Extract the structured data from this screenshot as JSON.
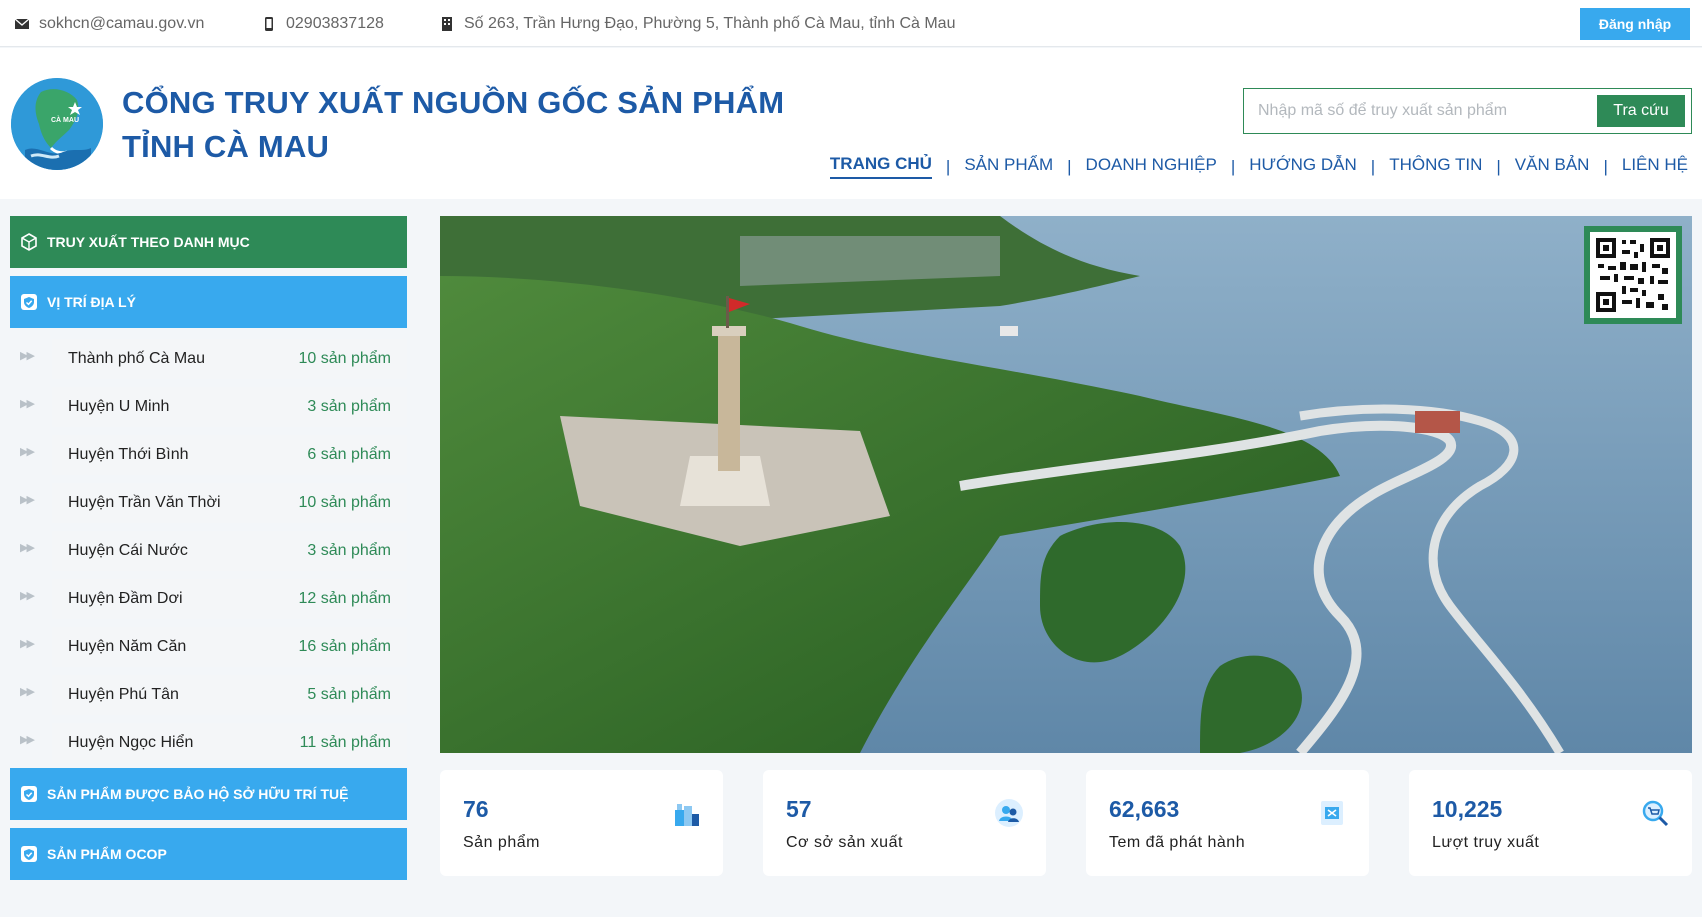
{
  "topbar": {
    "email": "sokhcn@camau.gov.vn",
    "phone": "02903837128",
    "address": "Số 263, Trần Hưng Đạo, Phường 5, Thành phố Cà Mau, tỉnh Cà Mau",
    "login_label": "Đăng nhập"
  },
  "header": {
    "logo_text": "CÀ MAU",
    "title_line1": "CỔNG TRUY XUẤT NGUỒN GỐC SẢN PHẨM",
    "title_line2": "TỈNH CÀ MAU",
    "search_placeholder": "Nhập mã số để truy xuất sản phẩm",
    "search_button": "Tra cứu"
  },
  "nav": {
    "items": [
      {
        "label": "TRANG CHỦ",
        "active": true
      },
      {
        "label": "SẢN PHẨM"
      },
      {
        "label": "DOANH NGHIỆP"
      },
      {
        "label": "HƯỚNG DẪN"
      },
      {
        "label": "THÔNG TIN"
      },
      {
        "label": "VĂN BẢN"
      },
      {
        "label": "LIÊN HỆ"
      }
    ]
  },
  "sidebar": {
    "category_header": "TRUY XUẤT THEO DANH MỤC",
    "geo_header": "VỊ TRÍ ĐỊA LÝ",
    "locations": [
      {
        "name": "Thành phố Cà Mau",
        "count": "10 sản phẩm"
      },
      {
        "name": "Huyện U Minh",
        "count": "3 sản phẩm"
      },
      {
        "name": "Huyện Thới Bình",
        "count": "6 sản phẩm"
      },
      {
        "name": "Huyện Trần Văn Thời",
        "count": "10 sản phẩm"
      },
      {
        "name": "Huyện Cái Nước",
        "count": "3 sản phẩm"
      },
      {
        "name": "Huyện Đầm Dơi",
        "count": "12 sản phẩm"
      },
      {
        "name": "Huyện Năm Căn",
        "count": "16 sản phẩm"
      },
      {
        "name": "Huyện Phú Tân",
        "count": "5 sản phẩm"
      },
      {
        "name": "Huyện Ngọc Hiển",
        "count": "11 sản phẩm"
      }
    ],
    "ip_header": "SẢN PHẨM ĐƯỢC BẢO HỘ SỞ HỮU TRÍ TUỆ",
    "ocop_header": "SẢN PHẨM OCOP"
  },
  "stats": [
    {
      "value": "76",
      "label": "Sản phẩm",
      "icon": "product-icon"
    },
    {
      "value": "57",
      "label": "Cơ sở sản xuất",
      "icon": "users-icon"
    },
    {
      "value": "62,663",
      "label": "Tem đã phát hành",
      "icon": "stamp-icon"
    },
    {
      "value": "10,225",
      "label": "Lượt truy xuất",
      "icon": "search-cart-icon"
    }
  ],
  "colors": {
    "green": "#2e8a57",
    "blue": "#38a9ee",
    "navy": "#1d5aa6"
  }
}
